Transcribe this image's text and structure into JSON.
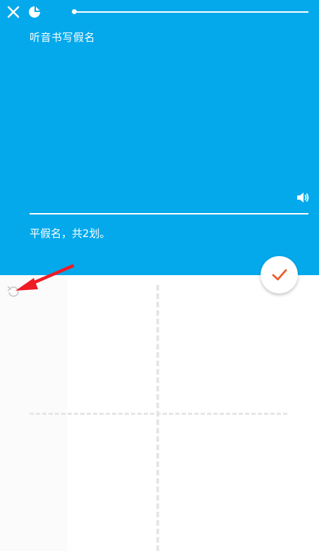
{
  "header": {
    "close_icon": "close-icon",
    "mascot_icon": "mascot-icon",
    "progress": 0.01
  },
  "question": {
    "prompt": "听音书写假名",
    "speaker_icon": "speaker-icon",
    "hint": "平假名，共2划。"
  },
  "actions": {
    "check_icon": "checkmark-icon",
    "undo_icon": "undo-icon"
  },
  "annotation": {
    "arrow_icon": "red-arrow-icon"
  },
  "colors": {
    "panel": "#03a9eb",
    "check": "#f05a28",
    "arrow": "#ee1c25",
    "guide": "#e6e6e6"
  }
}
